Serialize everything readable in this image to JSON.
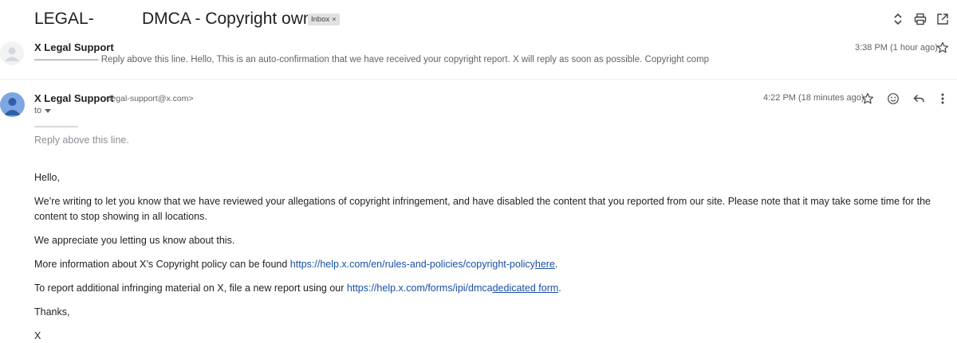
{
  "thread": {
    "subject_prefix": "LEGAL-",
    "subject": "DMCA - Copyright owner",
    "label_chip": "Inbox",
    "label_chip_remove": "×"
  },
  "toolbar_icons": [
    "expand-collapse-icon",
    "print-icon",
    "open-new-window-icon"
  ],
  "collapsed_message": {
    "sender": "X Legal Support",
    "snippet": "——————— Reply above this line. Hello, This is an auto-confirmation that we have received your copyright report. X will reply as soon as possible. Copyright comp",
    "time": "3:38 PM (1 hour ago)"
  },
  "open_message": {
    "sender": "X Legal Support",
    "sender_email": "<legal-support@x.com>",
    "to_label": "to",
    "time": "4:22 PM (18 minutes ago)",
    "rule": "—————",
    "reply_above": "Reply above this line.",
    "greeting": "Hello,",
    "paragraph1": "We’re writing to let you know that we have reviewed your allegations of copyright infringement, and have disabled the content that you reported from our site. Please note that it may take some time for the content to stop showing in all locations.",
    "paragraph2": "We appreciate you letting us know about this.",
    "paragraph3": {
      "prefix": "More information about X’s Copyright policy can be found ",
      "url": "https://help.x.com/en/rules-and-policies/copyright-policy",
      "link_text": "here",
      "suffix": "."
    },
    "paragraph4": {
      "prefix": "To report additional infringing material on X, file a new report using our ",
      "url": "https://help.x.com/forms/ipi/dmca",
      "link_text": "dedicated form",
      "suffix": "."
    },
    "signoff": "Thanks,",
    "signature": "X"
  },
  "colors": {
    "link": "#1a4fa3",
    "avatar_blue": "#7ea6e0",
    "chip_bg": "#e1e1e1"
  }
}
